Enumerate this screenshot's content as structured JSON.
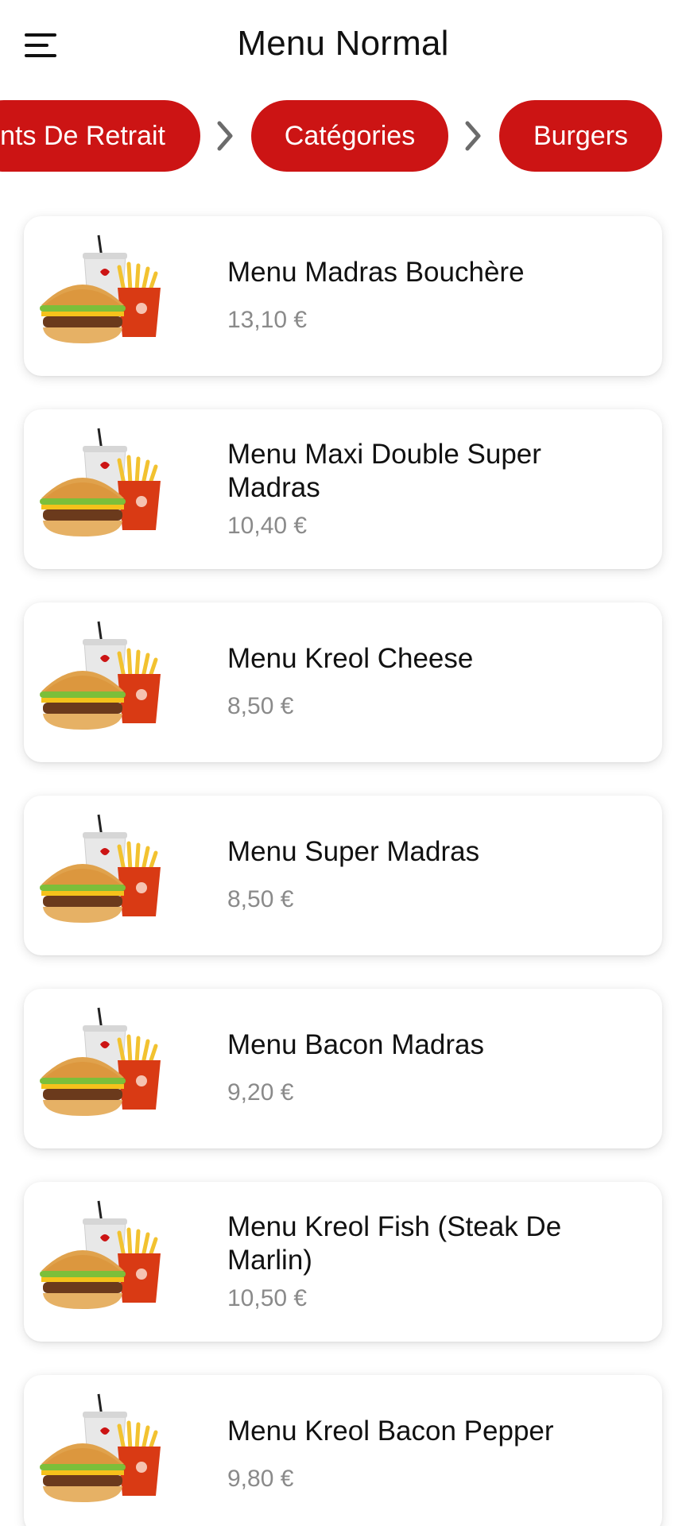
{
  "header": {
    "title": "Menu Normal",
    "menu_icon": "hamburger-menu-icon"
  },
  "breadcrumb": {
    "items": [
      {
        "label": "Points De Retrait"
      },
      {
        "label": "Catégories"
      },
      {
        "label": "Burgers"
      }
    ],
    "separator_icon": "chevron-right-icon"
  },
  "colors": {
    "accent": "#cc1414",
    "price": "#8a8a8a",
    "text": "#111111"
  },
  "products": [
    {
      "name": "Menu Madras Bouchère",
      "price": "13,10 €",
      "image": "burger-menu-image"
    },
    {
      "name": "Menu Maxi Double Super Madras",
      "price": "10,40 €",
      "image": "burger-menu-image"
    },
    {
      "name": "Menu Kreol Cheese",
      "price": "8,50 €",
      "image": "burger-menu-image"
    },
    {
      "name": "Menu Super Madras",
      "price": "8,50 €",
      "image": "burger-menu-image"
    },
    {
      "name": "Menu Bacon Madras",
      "price": "9,20 €",
      "image": "burger-menu-image"
    },
    {
      "name": "Menu Kreol Fish (Steak De Marlin)",
      "price": "10,50 €",
      "image": "burger-menu-image"
    },
    {
      "name": "Menu Kreol Bacon Pepper",
      "price": "9,80 €",
      "image": "burger-menu-image"
    }
  ]
}
